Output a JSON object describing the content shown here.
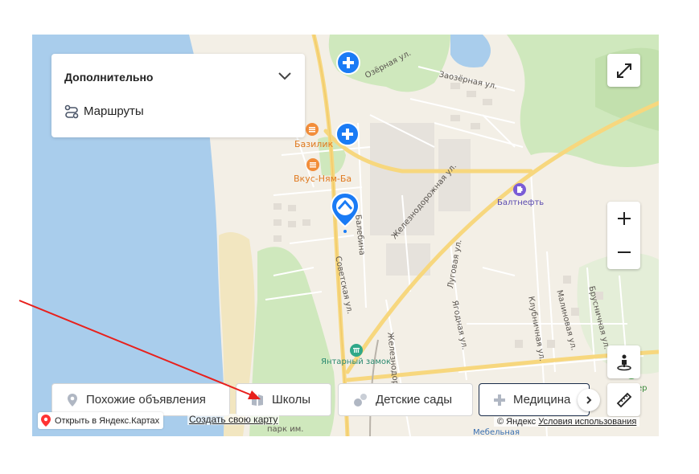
{
  "panel": {
    "title": "Дополнительно",
    "routes_label": "Маршруты"
  },
  "map_labels": {
    "ozernaya": "Озёрная ул.",
    "zaozernaya": "Заозёрная ул.",
    "bazilik": "Базилик",
    "vkus": "Вкус-Ням-Ба",
    "baltneft": "Балтнефть",
    "zheleznodorozhnaya": "Железнодорожная ул.",
    "zheleznodor2": "Железнодор",
    "sovetskaya": "Советская ул.",
    "lugovaya": "Луговая ул.",
    "yagodnaya": "Ягодная ул.",
    "klubnichnaya": "Клубничная ул.",
    "malinovaya": "Малиновая ул.",
    "brusnichnaya": "Брусничная ул.",
    "balebina": "ул. Балебина",
    "yantarny": "Янтарный замок",
    "park": "парк им.",
    "mebelnaya": "Мебельная",
    "er": "ер"
  },
  "chips": [
    {
      "label": "Похожие объявления",
      "icon": "pin-icon"
    },
    {
      "label": "Школы",
      "icon": "book-icon"
    },
    {
      "label": "Детские сады",
      "icon": "toys-icon"
    },
    {
      "label": "Медицина",
      "icon": "plus-icon"
    }
  ],
  "footer": {
    "open_yandex": "Открыть в Яндекс.Картах",
    "create_map": "Создать свою карту",
    "copyright": "© Яндекс",
    "terms": "Условия использования"
  },
  "colors": {
    "water": "#a9cdec",
    "park": "#cfe8bd",
    "road_main": "#f7d77e",
    "poi_food": "#f28d3a",
    "poi_medical": "#1a7bf5",
    "attraction": "#2fa889",
    "annotation_arrow": "#e8201c"
  }
}
